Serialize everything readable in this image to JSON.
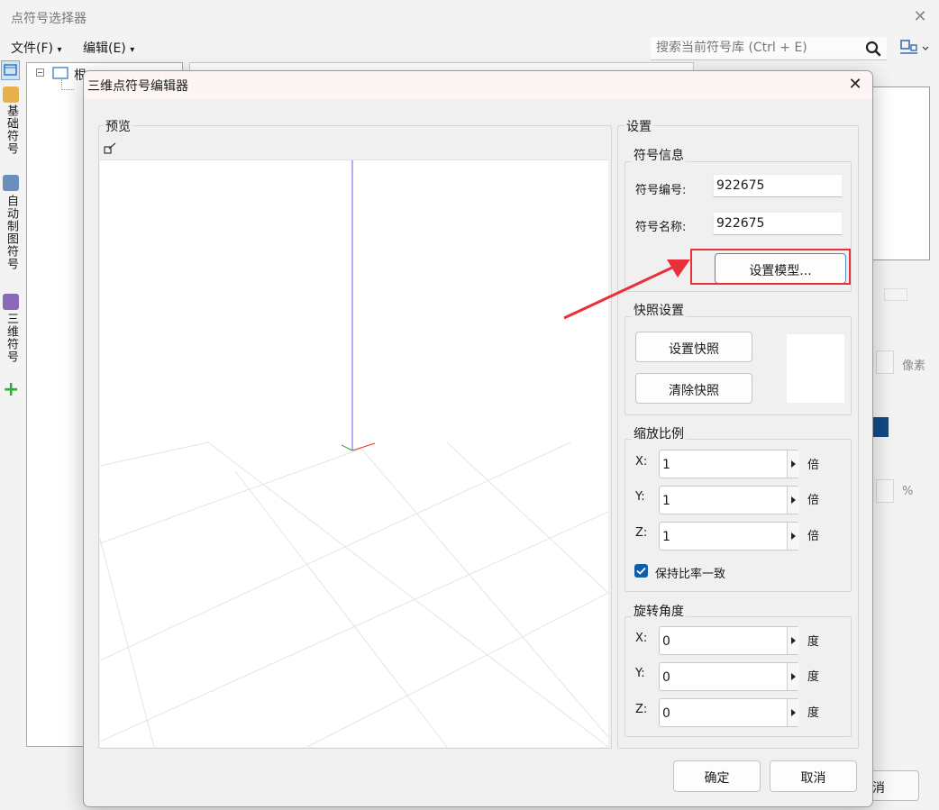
{
  "outer_window": {
    "title": "点符号选择器",
    "menu": [
      {
        "label": "文件(F)",
        "arrow": "▾"
      },
      {
        "label": "编辑(E)",
        "arrow": "▾"
      }
    ],
    "search_placeholder": "搜索当前符号库 (Ctrl + E)",
    "rail_tabs": [
      "基础符号",
      "自动制图符号",
      "三维符号"
    ],
    "tree_root": "根",
    "px_unit": "像素",
    "pct_unit": "%",
    "cancel_partial": "消"
  },
  "dialog": {
    "title": "三维点符号编辑器",
    "preview_label": "预览",
    "settings_label": "设置",
    "symbol_info": {
      "title": "符号信息",
      "id_label": "符号编号:",
      "id_value": "922675",
      "name_label": "符号名称:",
      "name_value": "922675",
      "set_model_button": "设置模型..."
    },
    "snapshot": {
      "title": "快照设置",
      "set_button": "设置快照",
      "clear_button": "清除快照"
    },
    "scale": {
      "title": "缩放比例",
      "rows": [
        {
          "axis": "X:",
          "value": "1",
          "unit": "倍"
        },
        {
          "axis": "Y:",
          "value": "1",
          "unit": "倍"
        },
        {
          "axis": "Z:",
          "value": "1",
          "unit": "倍"
        }
      ],
      "keep_ratio_label": "保持比率一致",
      "keep_ratio_checked": true
    },
    "rotation": {
      "title": "旋转角度",
      "rows": [
        {
          "axis": "X:",
          "value": "0",
          "unit": "度"
        },
        {
          "axis": "Y:",
          "value": "0",
          "unit": "度"
        },
        {
          "axis": "Z:",
          "value": "0",
          "unit": "度"
        }
      ]
    },
    "ok_button": "确定",
    "cancel_button": "取消"
  },
  "colors": {
    "accent": "#0f5fa8",
    "annotation": "#e8303a"
  }
}
